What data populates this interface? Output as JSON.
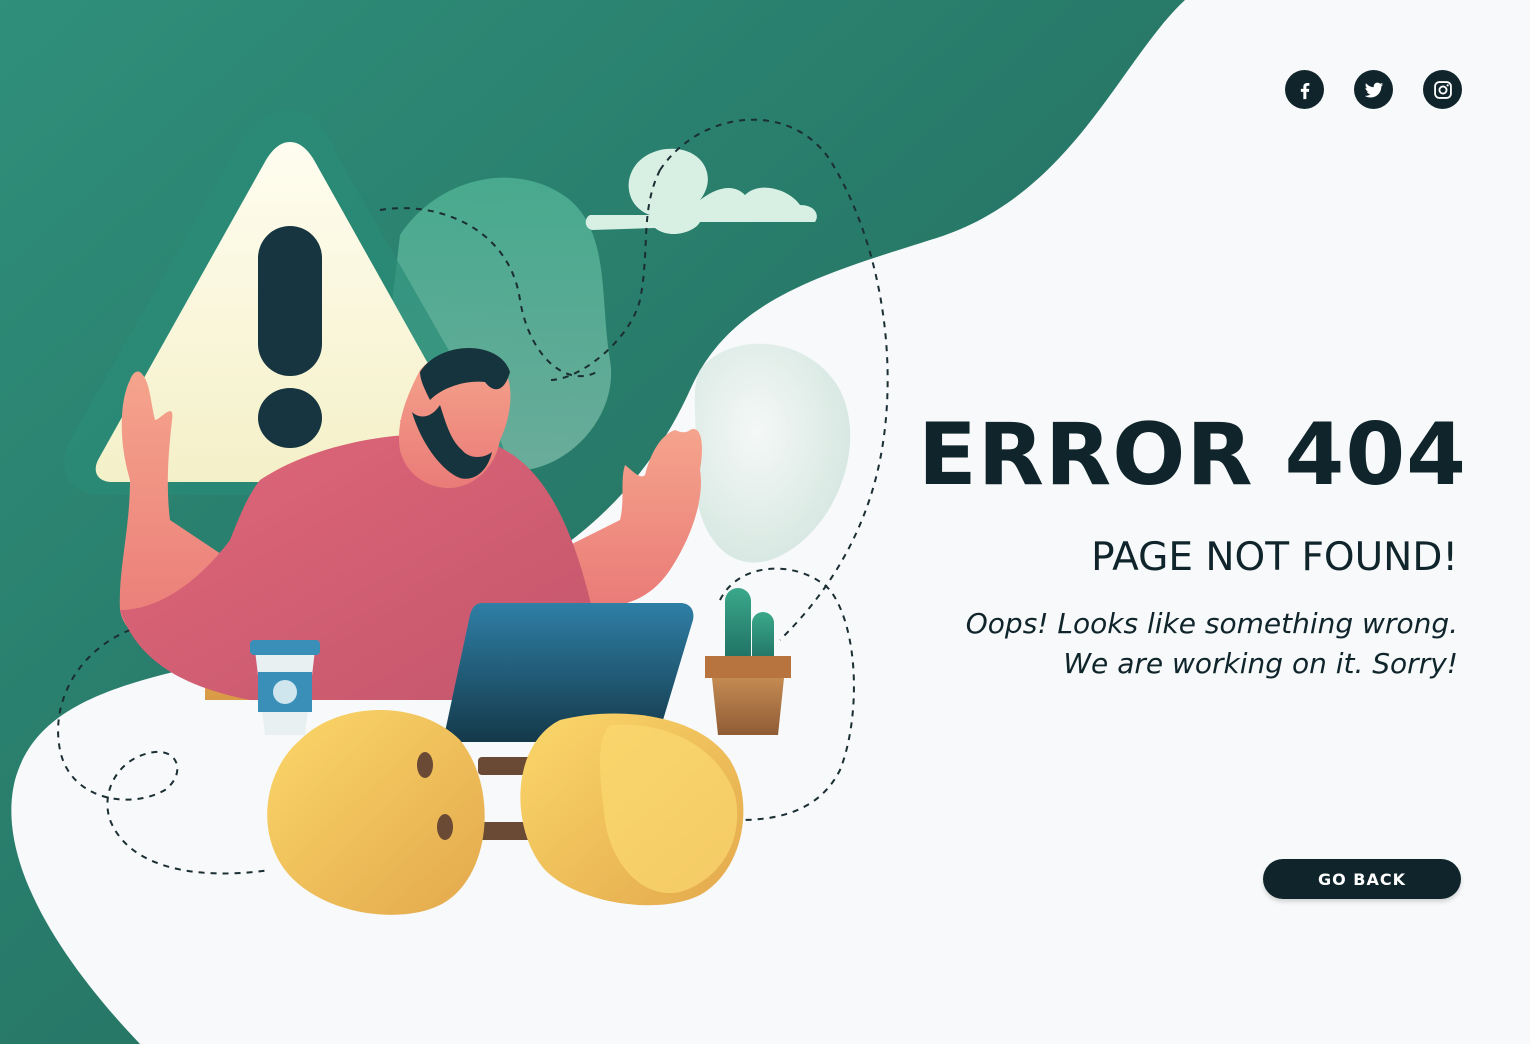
{
  "social": {
    "items": [
      {
        "name": "facebook",
        "icon": "facebook-icon"
      },
      {
        "name": "twitter",
        "icon": "twitter-icon"
      },
      {
        "name": "instagram",
        "icon": "instagram-icon"
      }
    ]
  },
  "content": {
    "title": "ERROR 404",
    "subtitle": "PAGE NOT FOUND!",
    "message_line1": "Oops! Looks like something  wrong.",
    "message_line2": "We are working on it. Sorry!"
  },
  "actions": {
    "go_back_label": "GO BACK"
  },
  "colors": {
    "primary_dark": "#0f252b",
    "teal": "#2b8475",
    "background": "#f7f9fa",
    "shirt": "#d4606f",
    "plug": "#f0c055",
    "warning_sign": "#fbf8dd"
  }
}
